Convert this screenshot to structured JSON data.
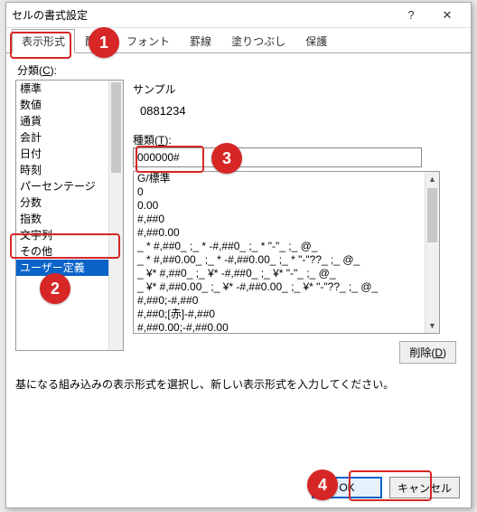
{
  "dialog": {
    "title": "セルの書式設定"
  },
  "tabs": {
    "display": "表示形式",
    "align": "配置",
    "font": "フォント",
    "border": "罫線",
    "fill": "塗りつぶし",
    "protect": "保護"
  },
  "category": {
    "label_prefix": "分類(",
    "label_key": "C",
    "label_suffix": "):",
    "items": [
      "標準",
      "数値",
      "通貨",
      "会計",
      "日付",
      "時刻",
      "パーセンテージ",
      "分数",
      "指数",
      "文字列",
      "その他",
      "ユーザー定義"
    ],
    "selected": "ユーザー定義"
  },
  "sample": {
    "label": "サンプル",
    "value": "0881234"
  },
  "type": {
    "label_prefix": "種類(",
    "label_key": "T",
    "label_suffix": "):",
    "value": "000000#"
  },
  "formats": [
    "G/標準",
    "0",
    "0.00",
    "#,##0",
    "#,##0.00",
    "_ * #,##0_ ;_ * -#,##0_ ;_ * \"-\"_ ;_ @_",
    "_ * #,##0.00_ ;_ * -#,##0.00_ ;_ * \"-\"??_ ;_ @_",
    "_ ¥* #,##0_ ;_ ¥* -#,##0_ ;_ ¥* \"-\"_ ;_ @_",
    "_ ¥* #,##0.00_ ;_ ¥* -#,##0.00_ ;_ ¥* \"-\"??_ ;_ @_",
    "#,##0;-#,##0",
    "#,##0;[赤]-#,##0",
    "#,##0.00;-#,##0.00"
  ],
  "delete": {
    "label_prefix": "削除(",
    "label_key": "D",
    "label_suffix": ")"
  },
  "hint": "基になる組み込みの表示形式を選択し、新しい表示形式を入力してください。",
  "footer": {
    "ok": "OK",
    "cancel": "キャンセル"
  },
  "badges": {
    "b1": "1",
    "b2": "2",
    "b3": "3",
    "b4": "4"
  }
}
